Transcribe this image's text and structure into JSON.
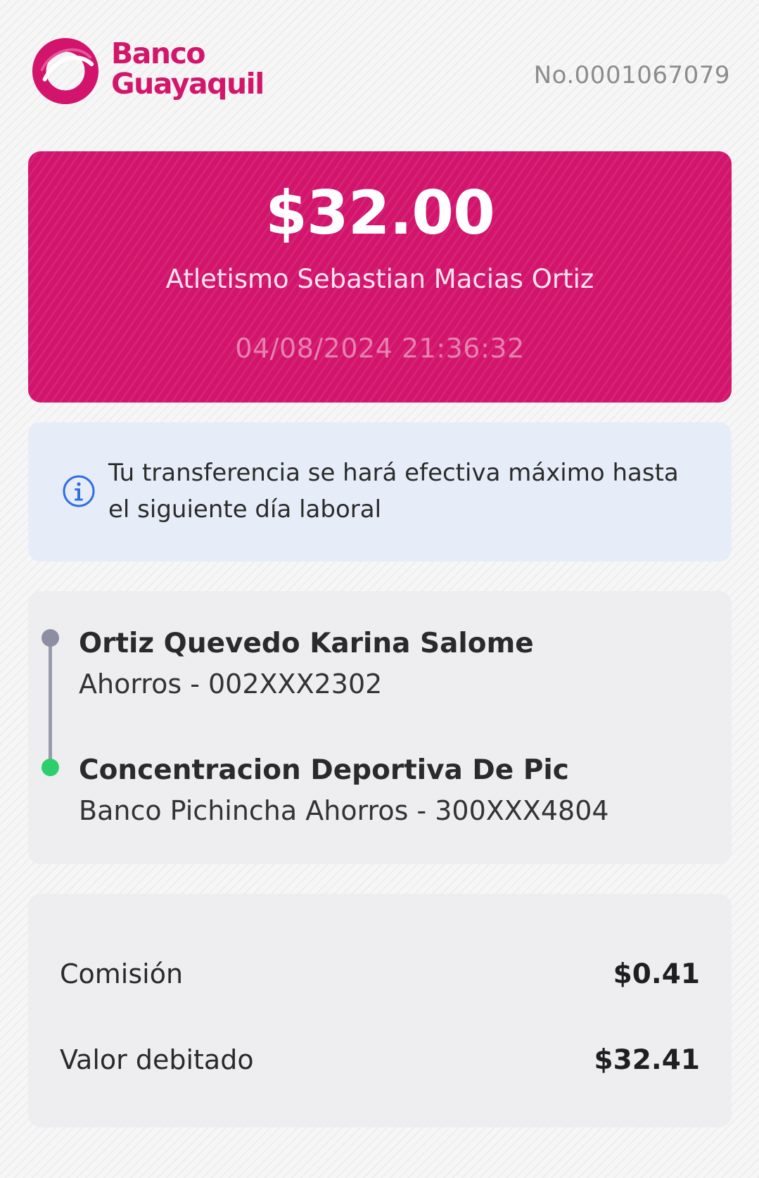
{
  "header": {
    "brand_line1": "Banco",
    "brand_line2": "Guayaquil",
    "receipt_number": "No.0001067079"
  },
  "transfer": {
    "amount": "$32.00",
    "description": "Atletismo Sebastian Macias Ortiz",
    "datetime": "04/08/2024 21:36:32"
  },
  "notice": {
    "line1": "Tu transferencia se hará efectiva máximo hasta",
    "line2": "el siguiente día laboral"
  },
  "parties": {
    "from": {
      "name": "Ortiz Quevedo Karina Salome",
      "account": "Ahorros - 002XXX2302"
    },
    "to": {
      "name": "Concentracion Deportiva De Pic",
      "account": "Banco Pichincha Ahorros - 300XXX4804"
    }
  },
  "summary": {
    "fee_label": "Comisión",
    "fee_value": "$0.41",
    "debited_label": "Valor debitado",
    "debited_value": "$32.41"
  },
  "colors": {
    "brand": "#d2146c",
    "info_bg": "#e6edf8",
    "info_icon": "#2f6fe0",
    "from_dot": "#8e8ea3",
    "to_dot": "#2dcf6d"
  }
}
